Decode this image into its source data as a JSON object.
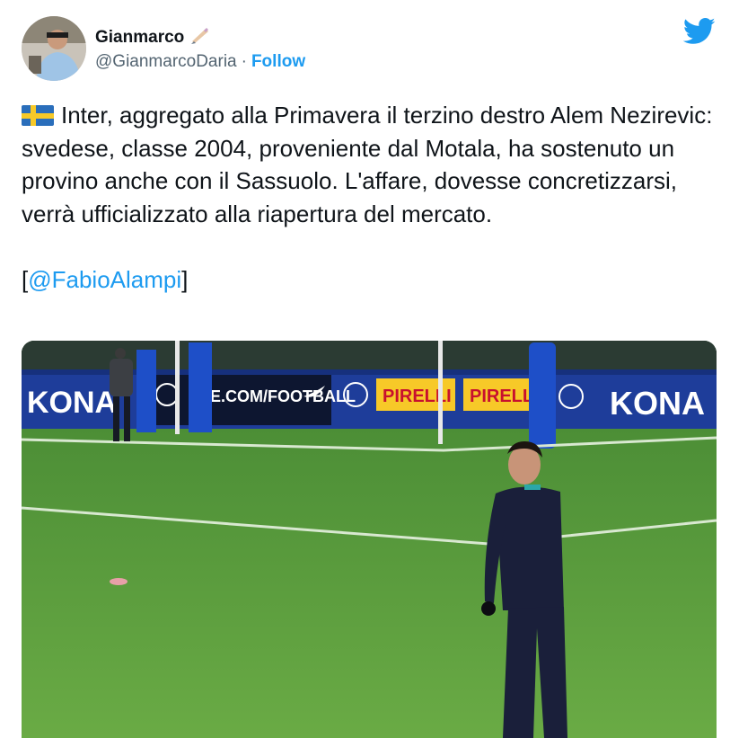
{
  "author": {
    "name": "Gianmarco",
    "name_emoji": "writing-hand",
    "handle": "@GianmarcoDaria",
    "separator": "·",
    "follow_label": "Follow"
  },
  "tweet": {
    "flag": "sweden-flag",
    "text": "Inter, aggregato alla Primavera il terzino destro Alem Nezirevic: svedese, classe 2004, proveniente dal Motala, ha sostenuto un provino anche con il Sassuolo. L'affare, dovesse concretizzarsi, verrà ufficializzato alla riapertura del mercato.",
    "mention_open": "[",
    "mention": "@FabioAlampi",
    "mention_close": "]"
  },
  "photo": {
    "boards": [
      "KONA",
      "E.COM/FOOTBALL",
      "PIRELLI",
      "PIRELLI",
      "KONA"
    ],
    "board_left_label": "KONA",
    "board_mid_label": "E.COM/FOOTBALL",
    "pirelli1": "PIRELLI",
    "pirelli2": "PIRELLI",
    "board_right_label": "KONA"
  },
  "colors": {
    "link": "#1d9bf0",
    "text": "#0f1419",
    "secondary": "#536471",
    "pitch": "#5a9a3c",
    "board": "#1e3d9a"
  }
}
